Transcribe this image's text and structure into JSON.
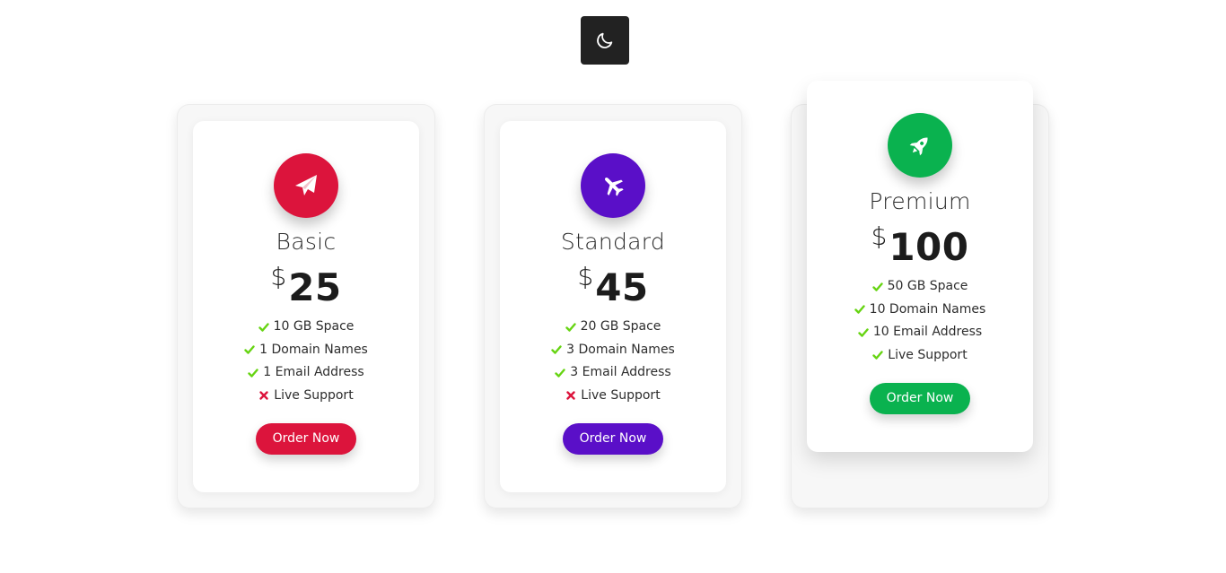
{
  "theme_toggle": {
    "icon": "moon-icon"
  },
  "plans": [
    {
      "name": "Basic",
      "currency": "$",
      "price": "25",
      "color": "#dc143c",
      "icon": "paper-plane-icon",
      "features": [
        {
          "text": "10 GB Space",
          "included": true
        },
        {
          "text": "1 Domain Names",
          "included": true
        },
        {
          "text": "1 Email Address",
          "included": true
        },
        {
          "text": "Live Support",
          "included": false
        }
      ],
      "button": "Order Now"
    },
    {
      "name": "Standard",
      "currency": "$",
      "price": "45",
      "color": "#5a0fc8",
      "icon": "airplane-icon",
      "features": [
        {
          "text": "20 GB Space",
          "included": true
        },
        {
          "text": "3 Domain Names",
          "included": true
        },
        {
          "text": "3 Email Address",
          "included": true
        },
        {
          "text": "Live Support",
          "included": false
        }
      ],
      "button": "Order Now"
    },
    {
      "name": "Premium",
      "currency": "$",
      "price": "100",
      "color": "#0ab24f",
      "icon": "rocket-icon",
      "features": [
        {
          "text": "50 GB Space",
          "included": true
        },
        {
          "text": "10 Domain Names",
          "included": true
        },
        {
          "text": "10 Email Address",
          "included": true
        },
        {
          "text": "Live Support",
          "included": true
        }
      ],
      "button": "Order Now"
    }
  ],
  "colors": {
    "check": "#66d412",
    "cross": "#dc143c"
  }
}
